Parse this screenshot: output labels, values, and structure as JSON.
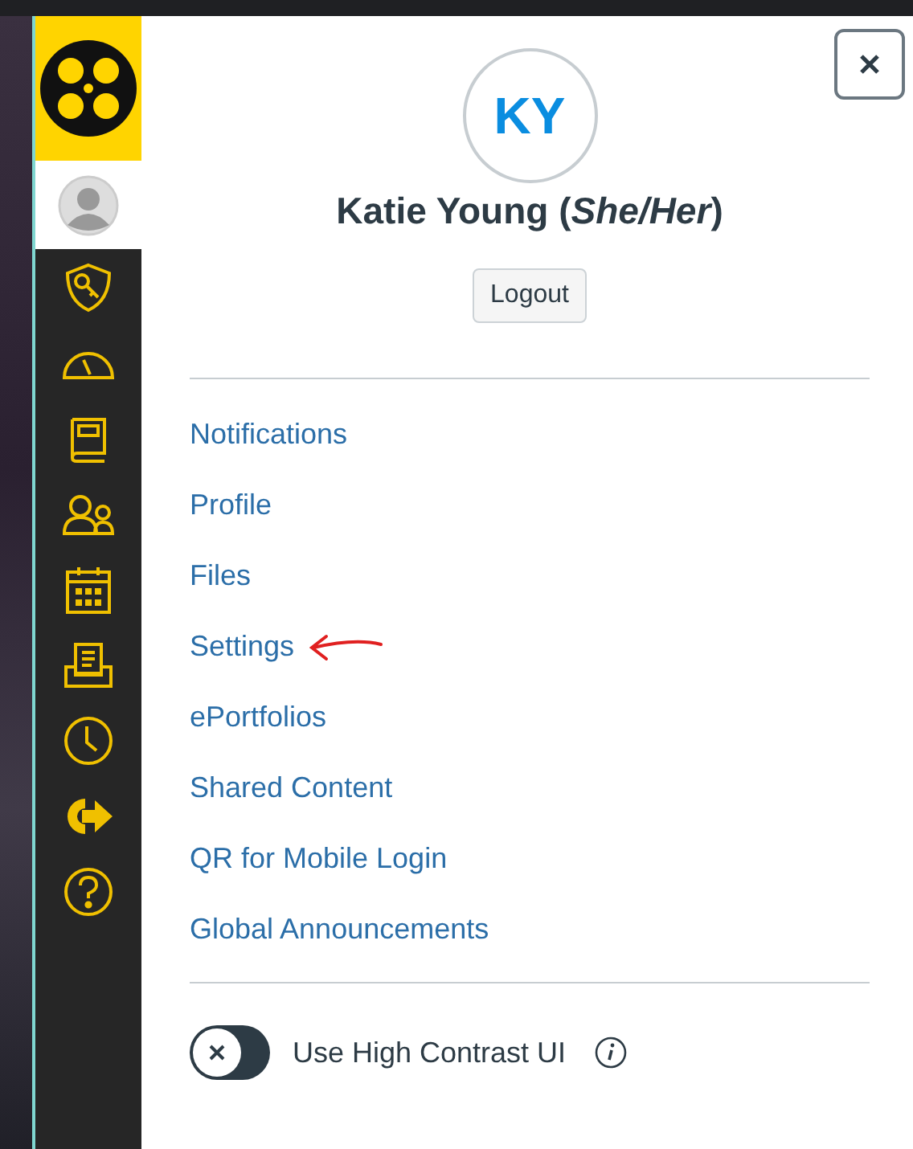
{
  "sidebar": {
    "items": [
      {
        "kind": "avatar",
        "selected": true
      },
      {
        "kind": "shield",
        "selected": false
      },
      {
        "kind": "gauge",
        "selected": false
      },
      {
        "kind": "book",
        "selected": false
      },
      {
        "kind": "people",
        "selected": false
      },
      {
        "kind": "calendar",
        "selected": false
      },
      {
        "kind": "inbox",
        "selected": false
      },
      {
        "kind": "clock",
        "selected": false
      },
      {
        "kind": "exit",
        "selected": false
      },
      {
        "kind": "help",
        "selected": false
      }
    ]
  },
  "profile": {
    "initials": "KY",
    "name": "Katie Young (*She/Her*)",
    "logout": "Logout"
  },
  "menu": [
    {
      "label": "Notifications",
      "annotated": false
    },
    {
      "label": "Profile",
      "annotated": false
    },
    {
      "label": "Files",
      "annotated": false
    },
    {
      "label": "Settings",
      "annotated": true
    },
    {
      "label": "ePortfolios",
      "annotated": false
    },
    {
      "label": "Shared Content",
      "annotated": false
    },
    {
      "label": "QR for Mobile Login",
      "annotated": false
    },
    {
      "label": "Global Announcements",
      "annotated": false
    }
  ],
  "high_contrast": {
    "label": "Use High Contrast UI",
    "on": false
  }
}
